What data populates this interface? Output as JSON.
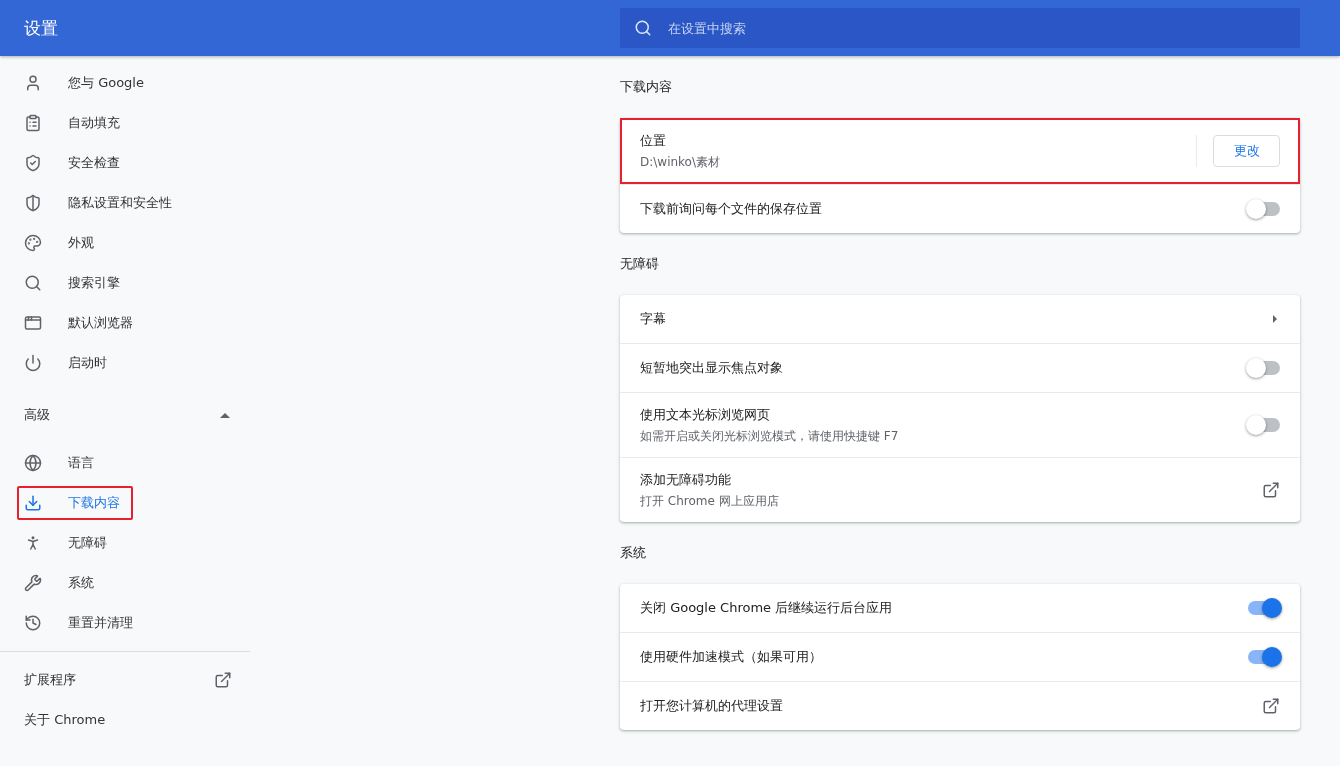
{
  "header": {
    "title": "设置",
    "search": {
      "placeholder": "在设置中搜索"
    }
  },
  "sidebar": {
    "items": [
      {
        "label": "您与 Google",
        "selected": false,
        "highlighted": false
      },
      {
        "label": "自动填充",
        "selected": false,
        "highlighted": false
      },
      {
        "label": "安全检查",
        "selected": false,
        "highlighted": false
      },
      {
        "label": "隐私设置和安全性",
        "selected": false,
        "highlighted": false
      },
      {
        "label": "外观",
        "selected": false,
        "highlighted": false
      },
      {
        "label": "搜索引擎",
        "selected": false,
        "highlighted": false
      },
      {
        "label": "默认浏览器",
        "selected": false,
        "highlighted": false
      },
      {
        "label": "启动时",
        "selected": false,
        "highlighted": false
      }
    ],
    "advanced": {
      "label": "高级",
      "expanded": true,
      "items": [
        {
          "label": "语言",
          "selected": false,
          "highlighted": false
        },
        {
          "label": "下载内容",
          "selected": true,
          "highlighted": true
        },
        {
          "label": "无障碍",
          "selected": false,
          "highlighted": false
        },
        {
          "label": "系统",
          "selected": false,
          "highlighted": false
        },
        {
          "label": "重置并清理",
          "selected": false,
          "highlighted": false
        }
      ]
    },
    "footer": [
      {
        "label": "扩展程序",
        "kind": "external"
      },
      {
        "label": "关于 Chrome",
        "kind": "plain"
      }
    ]
  },
  "sections": [
    {
      "title": "下载内容",
      "rows": [
        {
          "kind": "button",
          "title": "位置",
          "subtitle": "D:\\winko\\素材",
          "button": "更改",
          "highlighted": true
        },
        {
          "kind": "toggle",
          "title": "下载前询问每个文件的保存位置",
          "on": false
        }
      ]
    },
    {
      "title": "无障碍",
      "rows": [
        {
          "kind": "arrow",
          "title": "字幕"
        },
        {
          "kind": "toggle",
          "title": "短暂地突出显示焦点对象",
          "on": false
        },
        {
          "kind": "toggle",
          "title": "使用文本光标浏览网页",
          "subtitle": "如需开启或关闭光标浏览模式，请使用快捷键 F7",
          "on": false
        },
        {
          "kind": "external",
          "title": "添加无障碍功能",
          "subtitle": "打开 Chrome 网上应用店"
        }
      ]
    },
    {
      "title": "系统",
      "rows": [
        {
          "kind": "toggle",
          "title": "关闭 Google Chrome 后继续运行后台应用",
          "on": true
        },
        {
          "kind": "toggle",
          "title": "使用硬件加速模式（如果可用）",
          "on": true
        },
        {
          "kind": "external",
          "title": "打开您计算机的代理设置"
        }
      ]
    }
  ]
}
